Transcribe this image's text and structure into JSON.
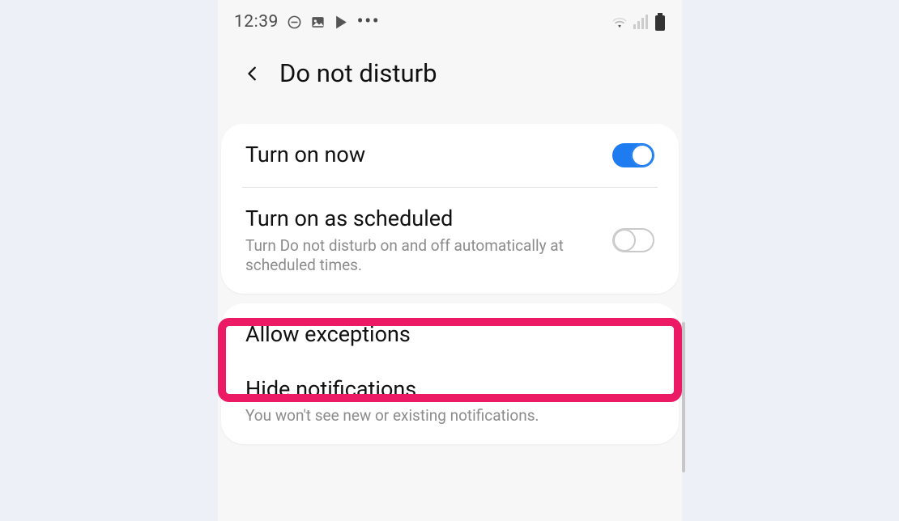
{
  "statusbar": {
    "time": "12:39",
    "icons_left": [
      "dnd-icon",
      "image-icon",
      "play-store-icon",
      "more-icon"
    ],
    "icons_right": [
      "wifi-icon",
      "signal-icon",
      "battery-icon"
    ]
  },
  "header": {
    "title": "Do not disturb"
  },
  "card1": {
    "turn_on_now": {
      "label": "Turn on now",
      "enabled": true
    },
    "turn_on_scheduled": {
      "label": "Turn on as scheduled",
      "description": "Turn Do not disturb on and off automatically at scheduled times.",
      "enabled": false
    }
  },
  "card2": {
    "allow_exceptions": {
      "label": "Allow exceptions"
    },
    "hide_notifications": {
      "label": "Hide notifications",
      "description": "You won't see new or existing notifications."
    }
  },
  "annotation": {
    "highlight_target": "allow-exceptions-row",
    "highlight_color": "#ec1a64"
  }
}
